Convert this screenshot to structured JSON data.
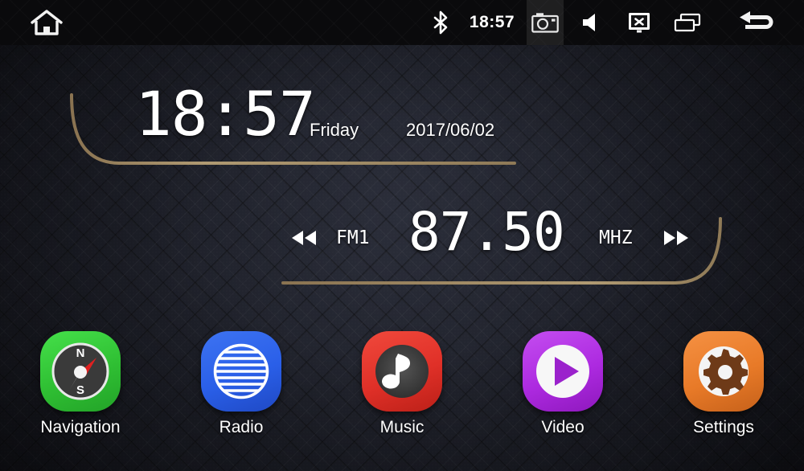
{
  "statusbar": {
    "time": "18:57",
    "items": [
      {
        "name": "home-icon",
        "label": "Home"
      },
      {
        "name": "bluetooth-icon",
        "label": "Bluetooth"
      },
      {
        "name": "clock-label",
        "label": "18:57"
      },
      {
        "name": "camera-icon",
        "label": "Camera"
      },
      {
        "name": "mute-icon",
        "label": "Mute"
      },
      {
        "name": "screen-off-icon",
        "label": "Screen Off"
      },
      {
        "name": "recent-apps-icon",
        "label": "Recent Apps"
      },
      {
        "name": "back-icon",
        "label": "Back"
      }
    ]
  },
  "clock": {
    "time": "18:57",
    "day": "Friday",
    "date": "2017/06/02"
  },
  "radio": {
    "prev_label": "◀◀",
    "band": "FM1",
    "frequency": "87.50",
    "unit": "MHZ",
    "next_label": "▶▶"
  },
  "apps": [
    {
      "id": "navigation",
      "label": "Navigation",
      "color": "#32cc32",
      "icon": "compass-icon"
    },
    {
      "id": "radio",
      "label": "Radio",
      "color": "#2a5fe8",
      "icon": "radio-grille-icon"
    },
    {
      "id": "music",
      "label": "Music",
      "color": "#e03028",
      "icon": "music-note-icon"
    },
    {
      "id": "video",
      "label": "Video",
      "color": "#ad2ae0",
      "icon": "play-icon"
    },
    {
      "id": "settings",
      "label": "Settings",
      "color": "#e87a28",
      "icon": "gear-icon"
    }
  ],
  "theme": {
    "accent_gold": "#9d8460",
    "background": "#22242e",
    "statusbar_bg": "#0a0a0c",
    "text": "#ffffff"
  }
}
